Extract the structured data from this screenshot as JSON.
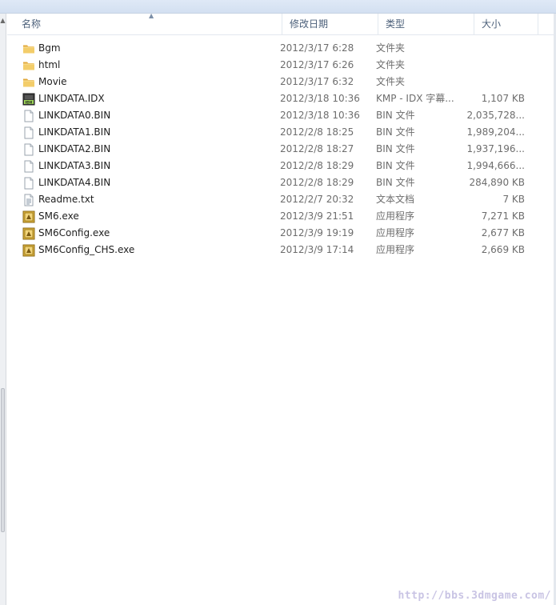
{
  "columns": {
    "name": "名称",
    "date": "修改日期",
    "type": "类型",
    "size": "大小"
  },
  "files": [
    {
      "name": "Bgm",
      "date": "2012/3/17 6:28",
      "type": "文件夹",
      "size": "",
      "icon": "folder-icon"
    },
    {
      "name": "html",
      "date": "2012/3/17 6:26",
      "type": "文件夹",
      "size": "",
      "icon": "folder-icon"
    },
    {
      "name": "Movie",
      "date": "2012/3/17 6:32",
      "type": "文件夹",
      "size": "",
      "icon": "folder-icon"
    },
    {
      "name": "LINKDATA.IDX",
      "date": "2012/3/18 10:36",
      "type": "KMP - IDX 字幕...",
      "size": "1,107 KB",
      "icon": "idx-file-icon"
    },
    {
      "name": "LINKDATA0.BIN",
      "date": "2012/3/18 10:36",
      "type": "BIN 文件",
      "size": "2,035,728...",
      "icon": "blank-file-icon"
    },
    {
      "name": "LINKDATA1.BIN",
      "date": "2012/2/8 18:25",
      "type": "BIN 文件",
      "size": "1,989,204...",
      "icon": "blank-file-icon"
    },
    {
      "name": "LINKDATA2.BIN",
      "date": "2012/2/8 18:27",
      "type": "BIN 文件",
      "size": "1,937,196...",
      "icon": "blank-file-icon"
    },
    {
      "name": "LINKDATA3.BIN",
      "date": "2012/2/8 18:29",
      "type": "BIN 文件",
      "size": "1,994,666...",
      "icon": "blank-file-icon"
    },
    {
      "name": "LINKDATA4.BIN",
      "date": "2012/2/8 18:29",
      "type": "BIN 文件",
      "size": "284,890 KB",
      "icon": "blank-file-icon"
    },
    {
      "name": "Readme.txt",
      "date": "2012/2/7 20:32",
      "type": "文本文档",
      "size": "7 KB",
      "icon": "text-file-icon"
    },
    {
      "name": "SM6.exe",
      "date": "2012/3/9 21:51",
      "type": "应用程序",
      "size": "7,271 KB",
      "icon": "exe-app-icon"
    },
    {
      "name": "SM6Config.exe",
      "date": "2012/3/9 19:19",
      "type": "应用程序",
      "size": "2,677 KB",
      "icon": "exe-app-icon"
    },
    {
      "name": "SM6Config_CHS.exe",
      "date": "2012/3/9 17:14",
      "type": "应用程序",
      "size": "2,669 KB",
      "icon": "exe-app-icon"
    }
  ],
  "watermark": "http://bbs.3dmgame.com/",
  "colors": {
    "header_text": "#4c607a",
    "folder": "#e8b84a",
    "secondary_text": "#6d6d6d"
  }
}
